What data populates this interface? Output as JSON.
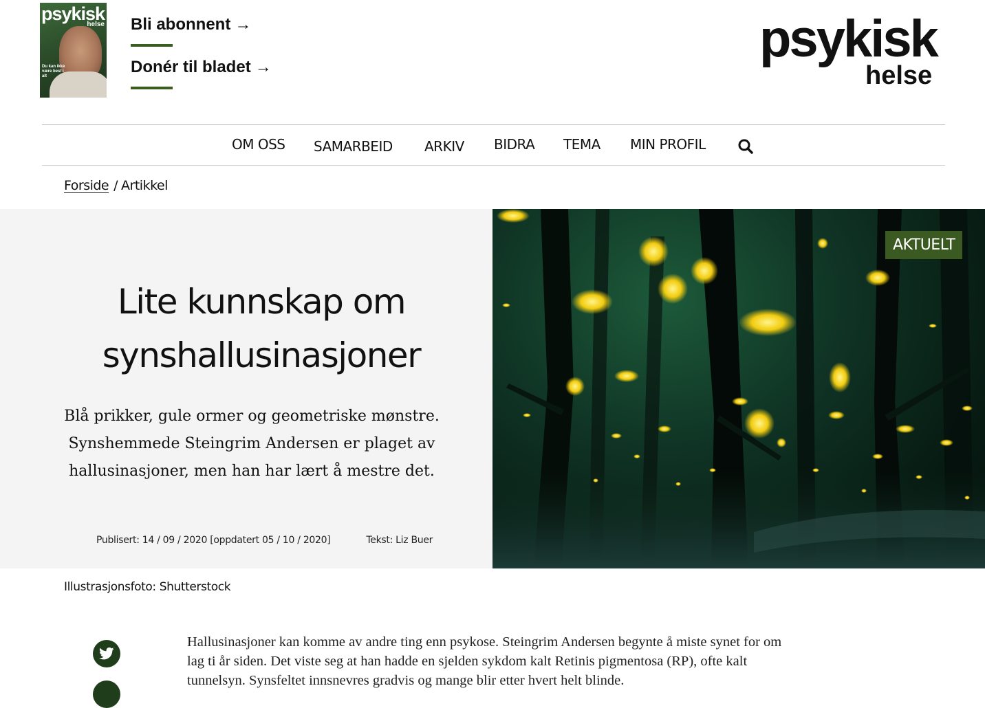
{
  "header": {
    "magazine_cover": {
      "title": "psykisk",
      "subtitle": "helse",
      "cover_line": "Du kan ikke være best i alt"
    },
    "links": [
      {
        "label": "Bli abonnent",
        "arrow": "→"
      },
      {
        "label": "Donér til bladet",
        "arrow": "→"
      }
    ],
    "logo": {
      "main": "psykisk",
      "sub": "helse"
    },
    "accent_color": "#3a5e22"
  },
  "nav": {
    "items": [
      "OM OSS",
      "SAMARBEID",
      "ARKIV",
      "BIDRA",
      "TEMA",
      "MIN PROFIL"
    ],
    "search_icon": "search-icon"
  },
  "breadcrumb": {
    "home": "Forside",
    "separator": "/",
    "current": "Artikkel"
  },
  "article": {
    "title": "Lite kunnskap om synshallusinasjoner",
    "lead": "Blå prikker, gule ormer og geometriske mønstre. Synshemmede Steingrim Andersen er plaget av hallusinasjoner, men han har lært å mestre det.",
    "published": "Publisert: 14 / 09 / 2020 [oppdatert 05 / 10 / 2020]",
    "byline": "Tekst:  Liz Buer",
    "category": "AKTUELT",
    "photo_credit": "Illustrasjonsfoto: Shutterstock",
    "body": "Hallusinasjoner kan komme av andre ting enn psykose. Steingrim Andersen begynte å miste synet for om lag ti år siden. Det viste seg at han hadde en sjelden sykdom kalt Retinis pigmentosa (RP), ofte kalt tunnelsyn. Synsfeltet innsnevres gradvis og mange blir etter hvert helt blinde."
  },
  "share": {
    "icons": [
      "twitter-icon"
    ],
    "icon_color": "#1f3d1a"
  },
  "colors": {
    "badge": "#3a5a22",
    "hero_bg": "#f4f4f4"
  }
}
